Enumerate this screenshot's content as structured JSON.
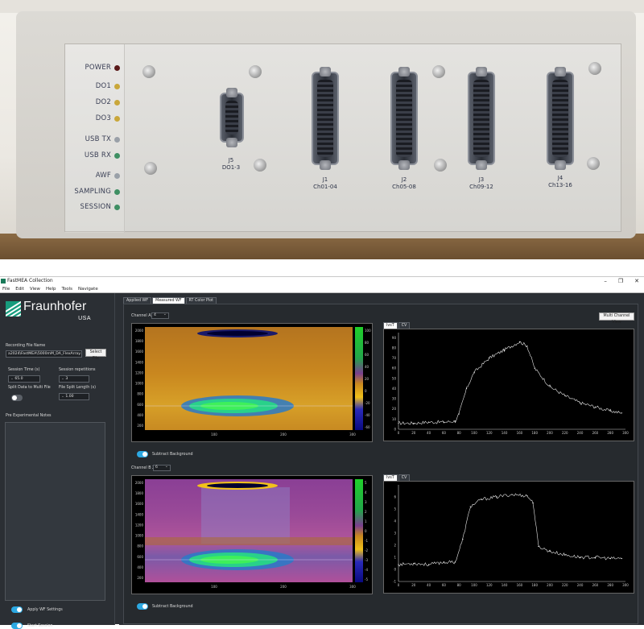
{
  "device": {
    "leds": [
      {
        "label": "POWER",
        "color": "#5a1a1a"
      },
      {
        "label": "DO1",
        "color": "#c9a73a"
      },
      {
        "label": "DO2",
        "color": "#c9a73a"
      },
      {
        "label": "DO3",
        "color": "#c9a73a"
      },
      {
        "label": "USB TX",
        "color": "#9aa0a8"
      },
      {
        "label": "USB RX",
        "color": "#3f8f63"
      },
      {
        "label": "AWF",
        "color": "#9aa0a8"
      },
      {
        "label": "SAMPLING",
        "color": "#3f8f63"
      },
      {
        "label": "SESSION",
        "color": "#3f8f63"
      }
    ],
    "connectors": [
      {
        "id": "J5",
        "label": "DO1-3"
      },
      {
        "id": "J1",
        "label": "Ch01-04"
      },
      {
        "id": "J2",
        "label": "Ch05-08"
      },
      {
        "id": "J3",
        "label": "Ch09-12"
      },
      {
        "id": "J4",
        "label": "Ch13-16"
      }
    ]
  },
  "window": {
    "title": "FastMEA Collection",
    "controls": [
      "–",
      "❐",
      "✕"
    ]
  },
  "menu": [
    "File",
    "Edit",
    "View",
    "Help",
    "Tools",
    "Navigate"
  ],
  "sidebar": {
    "logo_word": "Fraunhofer",
    "logo_sub": "USA",
    "recording_label": "Recording File Name",
    "recording_value": "a2024\\FastMEA\\5000mM_DA_FlexArray.csv",
    "select_file": "Select File",
    "session_time_label": "Session Time (s)",
    "session_time_value": "65.0",
    "session_reps_label": "Session repetitions",
    "session_reps_value": "3",
    "split_label": "Split Data to Multi File",
    "split_length_label": "File Split Length (s)",
    "split_length_value": "1.00",
    "notes_label": "Pre Experimental Notes",
    "apply_label": "Apply WF Settings",
    "start_label": "Start Session"
  },
  "main": {
    "tabs": [
      "Applied WF",
      "Measured WF",
      "RT Color Plot"
    ],
    "multi_view": "Multi Channel View",
    "channels": [
      {
        "label": "Channel A2",
        "value": "4",
        "subtract": "Subtract Background",
        "subtabs": [
          "IvsT",
          "CV"
        ]
      },
      {
        "label": "Channel B 2",
        "value": "6",
        "subtract": "Subtract Background",
        "subtabs": [
          "IvsT",
          "CV"
        ]
      }
    ]
  },
  "chart_data": [
    {
      "type": "heatmap",
      "xticks": [
        "100",
        "200",
        "300"
      ],
      "yticks": [
        "200",
        "400",
        "600",
        "800",
        "1000",
        "1200",
        "1400",
        "1600",
        "1800",
        "2000"
      ],
      "colorbar_ticks": [
        "100",
        "80",
        "60",
        "40",
        "20",
        "0",
        "-20",
        "-40",
        "-60"
      ]
    },
    {
      "type": "line",
      "xlim": [
        0,
        300
      ],
      "ylim": [
        0,
        95
      ],
      "xticks": [
        "0",
        "20",
        "40",
        "60",
        "80",
        "100",
        "120",
        "140",
        "160",
        "180",
        "200",
        "220",
        "240",
        "260",
        "280",
        "300"
      ],
      "yticks": [
        "0",
        "10",
        "20",
        "30",
        "40",
        "50",
        "60",
        "70",
        "80",
        "90"
      ],
      "x": [
        0,
        20,
        40,
        60,
        75,
        80,
        90,
        100,
        120,
        140,
        160,
        170,
        180,
        200,
        220,
        240,
        260,
        280,
        295
      ],
      "y": [
        6,
        6,
        7,
        7,
        8,
        15,
        40,
        56,
        70,
        78,
        86,
        82,
        60,
        42,
        33,
        26,
        22,
        18,
        16
      ]
    },
    {
      "type": "heatmap",
      "xticks": [
        "100",
        "200",
        "300"
      ],
      "yticks": [
        "200",
        "400",
        "600",
        "800",
        "1000",
        "1200",
        "1400",
        "1600",
        "1800",
        "2000"
      ],
      "colorbar_ticks": [
        "5",
        "4",
        "3",
        "2",
        "1",
        "0",
        "-1",
        "-2",
        "-3",
        "-4",
        "-5"
      ]
    },
    {
      "type": "line",
      "xlim": [
        0,
        300
      ],
      "ylim": [
        -1,
        7
      ],
      "xticks": [
        "0",
        "20",
        "40",
        "60",
        "80",
        "100",
        "120",
        "140",
        "160",
        "180",
        "200",
        "220",
        "240",
        "260",
        "280",
        "300"
      ],
      "yticks": [
        "-1",
        "0",
        "1",
        "2",
        "3",
        "4",
        "5",
        "6"
      ],
      "x": [
        0,
        20,
        40,
        60,
        75,
        85,
        95,
        110,
        130,
        150,
        170,
        178,
        185,
        200,
        220,
        240,
        260,
        280,
        295
      ],
      "y": [
        0.4,
        0.5,
        0.4,
        0.6,
        0.6,
        2.5,
        5.2,
        5.8,
        6.0,
        6.2,
        6.1,
        5.5,
        1.9,
        1.5,
        1.2,
        1.0,
        1.0,
        0.9,
        0.9
      ]
    }
  ]
}
